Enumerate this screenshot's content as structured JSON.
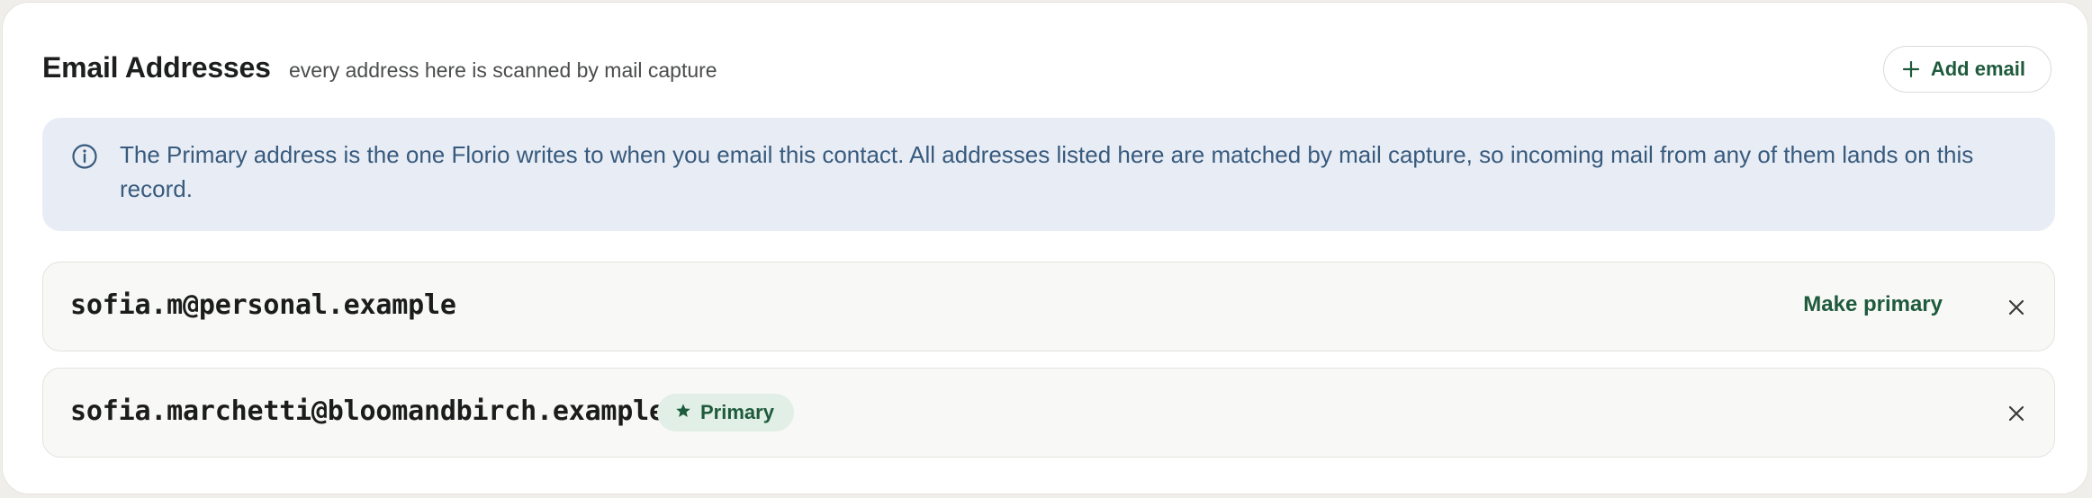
{
  "header": {
    "title": "Email Addresses",
    "subtitle": "every address here is scanned by mail capture",
    "add_button_label": "Add email"
  },
  "info": {
    "text": "The Primary address is the one Florio writes to when you email this contact. All addresses listed here are matched by mail capture, so incoming mail from any of them lands on this record."
  },
  "emails": [
    {
      "address": "sofia.m@personal.example",
      "action_label": "Make primary",
      "is_primary": false
    },
    {
      "address": "sofia.marchetti@bloomandbirch.example",
      "badge_label": "Primary",
      "is_primary": true
    }
  ],
  "icons": {
    "add": "plus-icon",
    "info": "info-icon",
    "remove": "close-icon",
    "primary_badge": "star-icon"
  },
  "colors": {
    "accent_green": "#1e5a3c",
    "info_background": "#e8edf5",
    "info_text": "#385a7d",
    "badge_background": "#e1efe6"
  }
}
